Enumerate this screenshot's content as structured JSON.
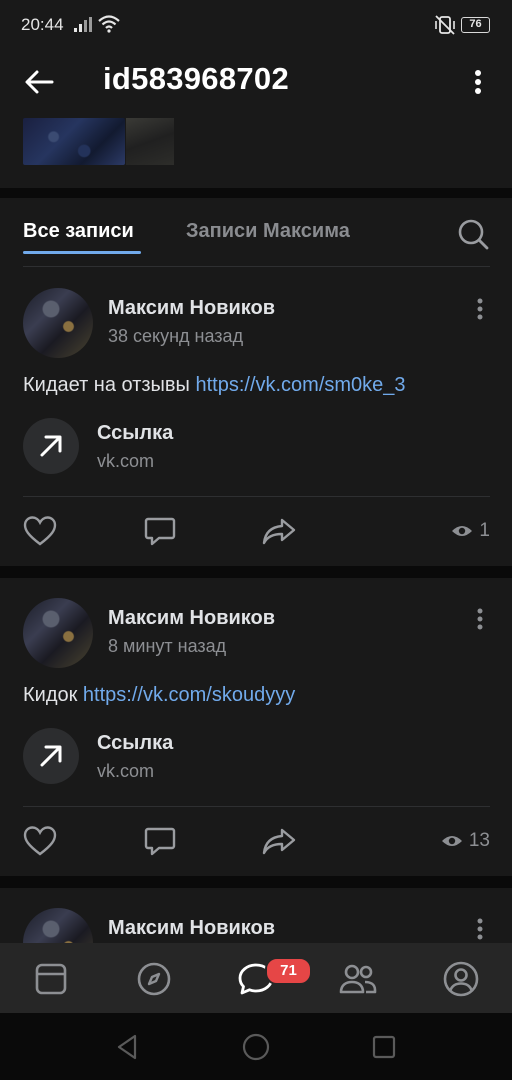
{
  "status_bar": {
    "time": "20:44",
    "battery": "76"
  },
  "header": {
    "title": "id583968702"
  },
  "tabs": {
    "all": "Все записи",
    "own": "Записи Максима"
  },
  "posts": [
    {
      "author": "Максим Новиков",
      "time": "38 секунд назад",
      "text": "Кидает на отзывы ",
      "link_text": "https://vk.com/sm0ke_3",
      "card_title": "Ссылка",
      "card_domain": "vk.com",
      "views": "1"
    },
    {
      "author": "Максим Новиков",
      "time": "8 минут назад",
      "text": "Кидок ",
      "link_text": "https://vk.com/skoudyyy",
      "card_title": "Ссылка",
      "card_domain": "vk.com",
      "views": "13"
    },
    {
      "author": "Максим Новиков"
    }
  ],
  "bottom_nav": {
    "items": [
      "news-icon",
      "discover-icon",
      "messages-icon",
      "friends-icon",
      "profile-icon"
    ],
    "messages_badge": "71"
  },
  "colors": {
    "accent": "#71aaeb",
    "badge": "#e64646",
    "background": "#191919"
  }
}
